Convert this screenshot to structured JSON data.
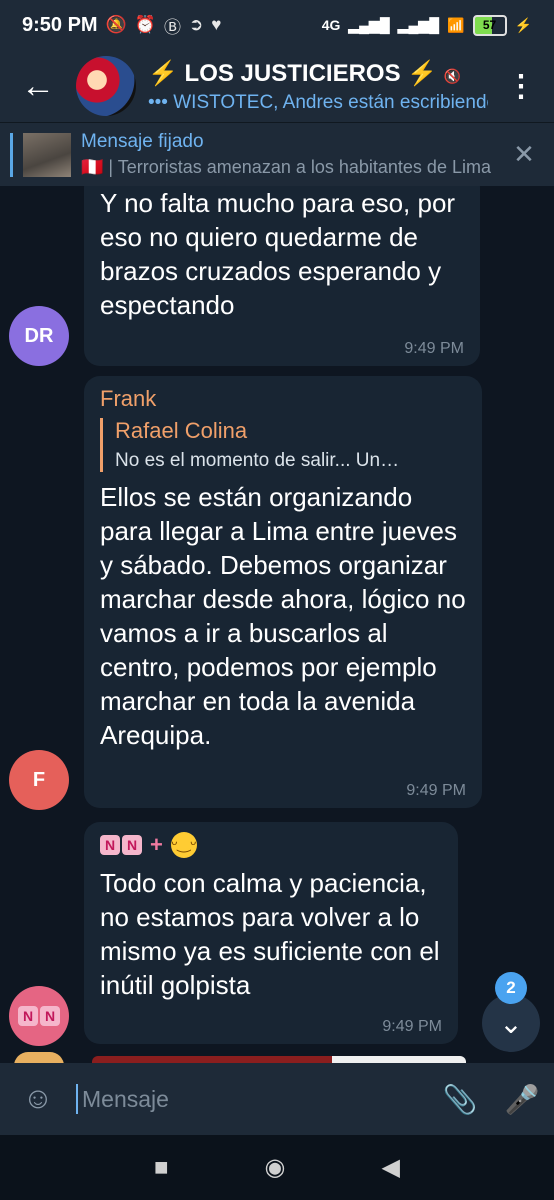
{
  "status_bar": {
    "time": "9:50 PM",
    "icons_left": [
      "mute-icon",
      "alarm-icon",
      "b-icon",
      "arrow-icon",
      "heart-icon"
    ],
    "network": "4G",
    "battery": "57"
  },
  "header": {
    "back_icon": "←",
    "title": "⚡ LOS JUSTICIEROS ⚡",
    "subtitle": "••• WISTOTEC, Andres están escribiendo",
    "menu_icon": "⋮"
  },
  "pinned": {
    "title": "Mensaje fijado",
    "text": "🇵🇪 | Terroristas amenazan a los habitantes de Lima",
    "close_icon": "✕"
  },
  "messages": [
    {
      "avatar_initials": "DR",
      "avatar_color": "#8a6fe0",
      "text": "Y no falta mucho para eso, por eso no quiero quedarme de brazos cruzados esperando y espectando",
      "time": "9:49 PM"
    },
    {
      "avatar_initials": "F",
      "avatar_color": "#e5605a",
      "sender": "Frank",
      "reply_name": "Rafael Colina",
      "reply_text": "No es el momento de salir... Un…",
      "text": "Ellos se están organizando para llegar a Lima entre jueves y sábado. Debemos organizar marchar desde ahora, lógico no vamos a ir a buscarlos al centro, podemos por ejemplo marchar en toda la avenida Arequipa.",
      "time": "9:49 PM"
    },
    {
      "avatar_color": "#e56583",
      "sender_badges": [
        "N",
        "N"
      ],
      "sender_plus": "+",
      "sender_emoji": "😁",
      "text": "Todo con calma y paciencia, no estamos para volver a lo mismo ya es suficiente con el inútil golpista",
      "time": "9:49 PM"
    }
  ],
  "scroll_down": {
    "badge_count": "2",
    "icon": "⌄"
  },
  "input": {
    "placeholder": "Mensaje",
    "emoji_icon": "☺",
    "attach_icon": "📎",
    "mic_icon": "🎤"
  },
  "navbar": {
    "square": "■",
    "circle": "◉",
    "back": "◀"
  }
}
